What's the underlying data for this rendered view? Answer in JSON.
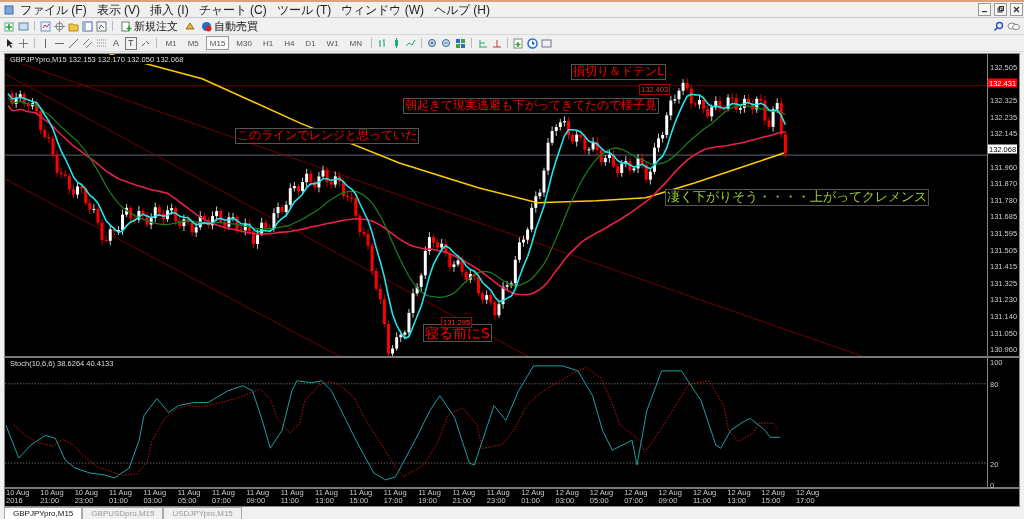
{
  "menu": [
    {
      "label": "ファイル (F)"
    },
    {
      "label": "表示 (V)"
    },
    {
      "label": "挿入 (I)"
    },
    {
      "label": "チャート (C)"
    },
    {
      "label": "ツール (T)"
    },
    {
      "label": "ウィンドウ (W)"
    },
    {
      "label": "ヘルプ (H)"
    }
  ],
  "toolbar": {
    "new_order": "新規注文",
    "auto_trading": "自動売買"
  },
  "drawing_tools": {
    "text_tool": "A",
    "label_tool": "T"
  },
  "timeframes": [
    {
      "label": "M1",
      "selected": false
    },
    {
      "label": "M5",
      "selected": false
    },
    {
      "label": "M15",
      "selected": true
    },
    {
      "label": "M30",
      "selected": false
    },
    {
      "label": "H1",
      "selected": false
    },
    {
      "label": "H4",
      "selected": false
    },
    {
      "label": "D1",
      "selected": false
    },
    {
      "label": "W1",
      "selected": false
    },
    {
      "label": "MN",
      "selected": false
    }
  ],
  "chart": {
    "header": "GBPJPYpro,M15  132.153 132.170 132.050 132.068",
    "price_axis": [
      "132.505",
      "132.325",
      "132.235",
      "132.145",
      "131.960",
      "131.870",
      "131.780",
      "131.685",
      "131.595",
      "131.505",
      "131.415",
      "131.325",
      "131.230",
      "131.140",
      "131.050",
      "130.960"
    ],
    "price_tags": [
      {
        "label": "132.431",
        "kind": "ask"
      },
      {
        "label": "132.068",
        "kind": "bid"
      }
    ],
    "annotations": [
      {
        "text": "損切り＆ドテンL",
        "color": "#ff0000"
      },
      {
        "text": "朝起きて現実逃避も下がってきてたので様子見",
        "color": "#ff0000"
      },
      {
        "text": "このラインでレンジと思っていた",
        "color": "#ff0000"
      },
      {
        "text": "寝る前にS",
        "color": "#ff0000"
      },
      {
        "text": "凄く下がりそう・・・・上がってクレメンス",
        "color": "#9acd32"
      }
    ],
    "order_tags": [
      "132.403",
      "131.295"
    ]
  },
  "indicator": {
    "header": "Stoch(10,6,6) 38.6264 40.4133",
    "levels": [
      "100",
      "80",
      "20",
      "0"
    ]
  },
  "time_axis": [
    "10 Aug 2016",
    "10 Aug 21:00",
    "10 Aug 23:00",
    "11 Aug 01:00",
    "11 Aug 03:00",
    "11 Aug 05:00",
    "11 Aug 07:00",
    "11 Aug 09:00",
    "11 Aug 11:00",
    "11 Aug 13:00",
    "11 Aug 15:00",
    "11 Aug 17:00",
    "11 Aug 19:00",
    "11 Aug 21:00",
    "11 Aug 23:00",
    "12 Aug 01:00",
    "12 Aug 03:00",
    "12 Aug 05:00",
    "12 Aug 07:00",
    "12 Aug 09:00",
    "12 Aug 11:00",
    "12 Aug 13:00",
    "12 Aug 15:00",
    "12 Aug 17:00"
  ],
  "tabs": [
    {
      "label": "GBPJPYpro,M15",
      "selected": true
    },
    {
      "label": "GBPUSDpro,M15",
      "selected": false
    },
    {
      "label": "USDJPYpro,M15",
      "selected": false
    }
  ]
}
